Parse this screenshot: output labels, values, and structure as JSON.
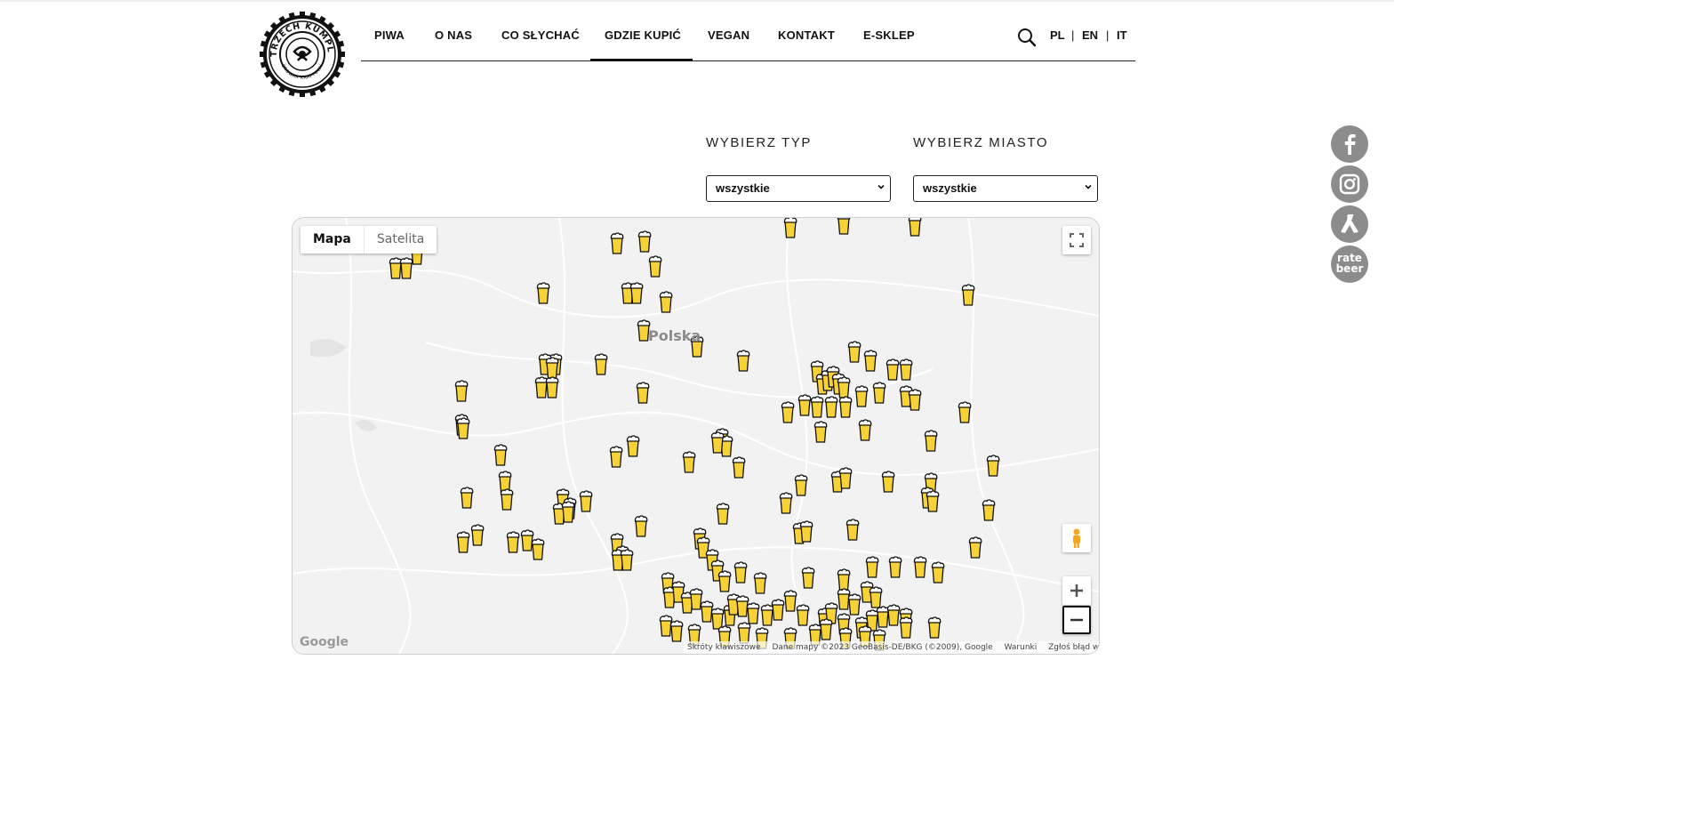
{
  "nav": {
    "items": [
      {
        "label": "PIWA"
      },
      {
        "label": "O NAS"
      },
      {
        "label": "CO SŁYCHAĆ"
      },
      {
        "label": "GDZIE KUPIĆ"
      },
      {
        "label": "VEGAN"
      },
      {
        "label": "KONTAKT"
      },
      {
        "label": "E-SKLEP"
      }
    ],
    "active": "GDZIE KUPIĆ",
    "languages": [
      "PL",
      "EN",
      "IT"
    ],
    "separator": "|"
  },
  "logo": {
    "text_top": "TRZECH KUMPLI",
    "text_bottom": "BROWAR KRAFTOWY"
  },
  "filters": {
    "type_label": "WYBIERZ TYP",
    "type_value": "wszystkie",
    "city_label": "WYBIERZ MIASTO",
    "city_value": "wszystkie"
  },
  "map": {
    "type_options": [
      "Mapa",
      "Satelita"
    ],
    "selected_type": "Mapa",
    "place_label": "Polska",
    "marker_icon": "beer-glass-icon",
    "marker_color": "#f6d237",
    "google_logo": "Google",
    "attribution": [
      "Skróty klawiszowe",
      "Dane mapy ©2023 GeoBasis-DE/BKG (©2009), Google",
      "Warunki",
      "Zgłoś błąd w mapach"
    ]
  },
  "social": [
    {
      "icon": "facebook-icon"
    },
    {
      "icon": "instagram-icon"
    },
    {
      "icon": "untappd-icon"
    },
    {
      "icon": "ratebeer-icon",
      "label_top": "rate",
      "label_bottom": "beer"
    }
  ],
  "colors": {
    "accent": "#111111",
    "marker": "#f6d237",
    "social_bg": "#8c8c8c"
  }
}
